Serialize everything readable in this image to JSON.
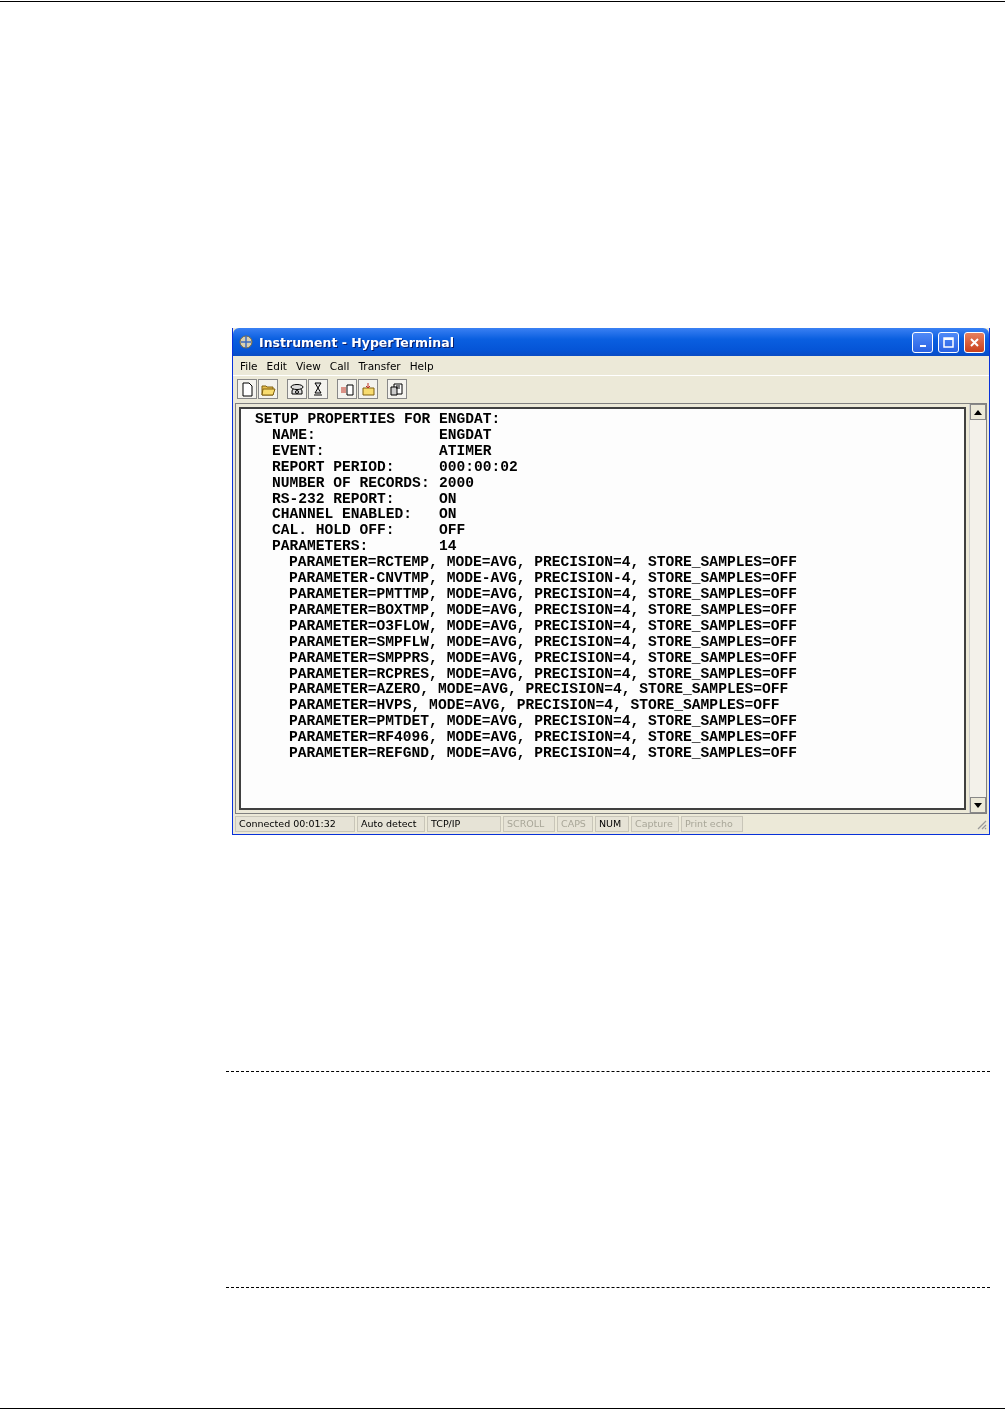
{
  "window": {
    "title": "Instrument - HyperTerminal"
  },
  "menu": [
    "File",
    "Edit",
    "View",
    "Call",
    "Transfer",
    "Help"
  ],
  "terminal": {
    "heading": "SETUP PROPERTIES FOR ENGDAT:",
    "settings": [
      {
        "label": "NAME:",
        "value": "ENGDAT"
      },
      {
        "label": "EVENT:",
        "value": "ATIMER"
      },
      {
        "label": "REPORT PERIOD:",
        "value": "000:00:02"
      },
      {
        "label": "NUMBER OF RECORDS:",
        "value": "2000"
      },
      {
        "label": "RS-232 REPORT:",
        "value": "ON"
      },
      {
        "label": "CHANNEL ENABLED:",
        "value": "ON"
      },
      {
        "label": "CAL. HOLD OFF:",
        "value": "OFF"
      },
      {
        "label": "PARAMETERS:",
        "value": "14"
      }
    ],
    "parameter_lines": [
      "PARAMETER=RCTEMP, MODE=AVG, PRECISION=4, STORE_SAMPLES=OFF",
      "PARAMETER-CNVTMP, MODE-AVG, PRECISION-4, STORE_SAMPLES=OFF",
      "PARAMETER=PMTTMP, MODE=AVG, PRECISION=4, STORE_SAMPLES=OFF",
      "PARAMETER=BOXTMP, MODE=AVG, PRECISION=4, STORE_SAMPLES=OFF",
      "PARAMETER=O3FLOW, MODE=AVG, PRECISION=4, STORE_SAMPLES=OFF",
      "PARAMETER=SMPFLW, MODE=AVG, PRECISION=4, STORE_SAMPLES=OFF",
      "PARAMETER=SMPPRS, MODE=AVG, PRECISION=4, STORE_SAMPLES=OFF",
      "PARAMETER=RCPRES, MODE=AVG, PRECISION=4, STORE_SAMPLES=OFF",
      "PARAMETER=AZERO, MODE=AVG, PRECISION=4, STORE_SAMPLES=OFF",
      "PARAMETER=HVPS, MODE=AVG, PRECISION=4, STORE_SAMPLES=OFF",
      "PARAMETER=PMTDET, MODE=AVG, PRECISION=4, STORE_SAMPLES=OFF",
      "PARAMETER=RF4096, MODE=AVG, PRECISION=4, STORE_SAMPLES=OFF",
      "PARAMETER=REFGND, MODE=AVG, PRECISION=4, STORE_SAMPLES=OFF"
    ]
  },
  "status_bar": [
    {
      "text": "Connected 00:01:32",
      "active": true
    },
    {
      "text": "Auto detect",
      "active": true
    },
    {
      "text": "TCP/IP",
      "active": true
    },
    {
      "text": "SCROLL",
      "active": false
    },
    {
      "text": "CAPS",
      "active": false
    },
    {
      "text": "NUM",
      "active": true
    },
    {
      "text": "Capture",
      "active": false
    },
    {
      "text": "Print echo",
      "active": false
    }
  ]
}
